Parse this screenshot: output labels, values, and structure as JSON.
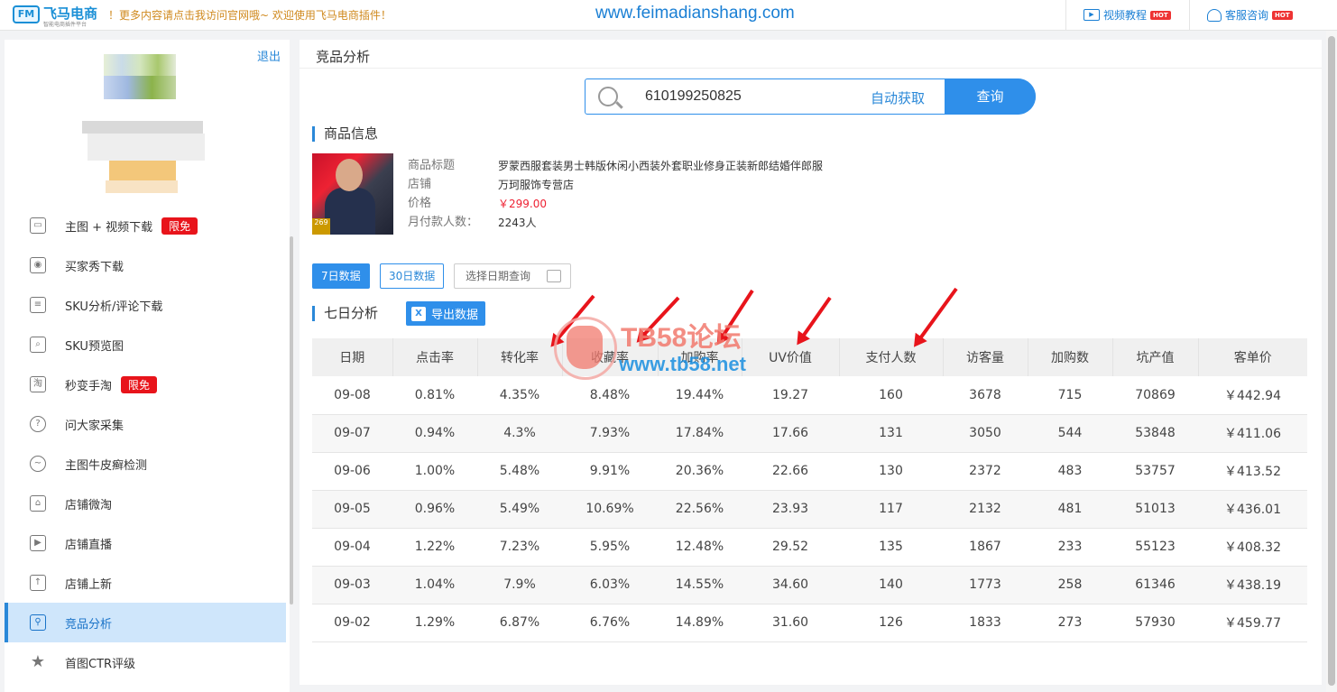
{
  "topbar": {
    "logo_mark": "FM",
    "logo_text": "飞马电商",
    "logo_sub": "智能电商插件平台",
    "marquee": "！更多内容请点击我访问官网哦~ 欢迎使用飞马电商插件！",
    "site_url": "www.feimadianshang.com",
    "video_tutorial": "视频教程",
    "customer_service": "客服咨询",
    "hot": "HOT"
  },
  "sidebar": {
    "logout": "退出",
    "items": [
      {
        "label": "主图 + 视频下载",
        "tag": "限免",
        "icon": "image-icon"
      },
      {
        "label": "买家秀下载",
        "icon": "camera-icon"
      },
      {
        "label": "SKU分析/评论下载",
        "icon": "comment-icon"
      },
      {
        "label": "SKU预览图",
        "icon": "preview-icon"
      },
      {
        "label": "秒变手淘",
        "tag": "限免",
        "icon": "taobao-icon"
      },
      {
        "label": "问大家采集",
        "icon": "question-icon"
      },
      {
        "label": "主图牛皮癣检测",
        "icon": "detect-icon"
      },
      {
        "label": "店铺微淘",
        "icon": "store-icon"
      },
      {
        "label": "店铺直播",
        "icon": "live-icon"
      },
      {
        "label": "店铺上新",
        "icon": "upload-icon"
      },
      {
        "label": "竞品分析",
        "icon": "analysis-icon",
        "active": true
      },
      {
        "label": "首图CTR评级",
        "icon": "star-icon"
      }
    ]
  },
  "main": {
    "title": "竞品分析",
    "search": {
      "value": "610199250825",
      "auto_fetch": "自动获取",
      "query": "查询"
    },
    "product_section": "商品信息",
    "product": {
      "title_label": "商品标题",
      "title": "罗蒙西服套装男士韩版休闲小西装外套职业修身正装新郎结婚伴郎服",
      "store_label": "店铺",
      "store": "万珂服饰专营店",
      "price_label": "价格",
      "price": "￥299.00",
      "monthly_label": "月付款人数：",
      "monthly": "2243人"
    },
    "ranges": {
      "seven": "7日数据",
      "thirty": "30日数据",
      "pick": "选择日期查询"
    },
    "analysis_section": "七日分析",
    "export": "导出数据",
    "excel_letter": "X",
    "table": {
      "headers": [
        "日期",
        "点击率",
        "转化率",
        "收藏率",
        "加购率",
        "UV价值",
        "支付人数",
        "访客量",
        "加购数",
        "坑产值",
        "客单价"
      ],
      "rows": [
        [
          "09-08",
          "0.81%",
          "4.35%",
          "8.48%",
          "19.44%",
          "19.27",
          "160",
          "3678",
          "715",
          "70869",
          "￥442.94"
        ],
        [
          "09-07",
          "0.94%",
          "4.3%",
          "7.93%",
          "17.84%",
          "17.66",
          "131",
          "3050",
          "544",
          "53848",
          "￥411.06"
        ],
        [
          "09-06",
          "1.00%",
          "5.48%",
          "9.91%",
          "20.36%",
          "22.66",
          "130",
          "2372",
          "483",
          "53757",
          "￥413.52"
        ],
        [
          "09-05",
          "0.96%",
          "5.49%",
          "10.69%",
          "22.56%",
          "23.93",
          "117",
          "2132",
          "481",
          "51013",
          "￥436.01"
        ],
        [
          "09-04",
          "1.22%",
          "7.23%",
          "5.95%",
          "12.48%",
          "29.52",
          "135",
          "1867",
          "233",
          "55123",
          "￥408.32"
        ],
        [
          "09-03",
          "1.04%",
          "7.9%",
          "6.03%",
          "14.55%",
          "34.60",
          "140",
          "1773",
          "258",
          "61346",
          "￥438.19"
        ],
        [
          "09-02",
          "1.29%",
          "6.87%",
          "6.76%",
          "14.89%",
          "31.60",
          "126",
          "1833",
          "273",
          "57930",
          "￥459.77"
        ]
      ]
    }
  },
  "watermark": {
    "title": "TB58论坛",
    "url": "www.tb58.net"
  },
  "colors": {
    "accent": "#2f8fea",
    "active_bg": "#cfe6fb",
    "tag": "#e8141b",
    "price": "#e23"
  }
}
